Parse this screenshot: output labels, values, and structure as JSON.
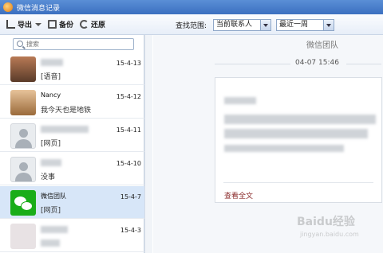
{
  "window": {
    "title": "微信消息记录"
  },
  "toolbar": {
    "export_label": "导出",
    "backup_label": "备份",
    "restore_label": "还原",
    "range_label": "查找范围:",
    "contact_select": "当前联系人",
    "period_select": "最近一周"
  },
  "sidebar": {
    "search_placeholder": "搜索",
    "items": [
      {
        "name": "",
        "date": "15-4-13",
        "preview": "[语音]",
        "avatar": "photo1"
      },
      {
        "name": "Nancy",
        "date": "15-4-12",
        "preview": "我今天也是地铁",
        "avatar": "photo2"
      },
      {
        "name": "",
        "date": "15-4-11",
        "preview": "[网页]",
        "avatar": "default"
      },
      {
        "name": "",
        "date": "15-4-10",
        "preview": "没事",
        "avatar": "default"
      },
      {
        "name": "微信团队",
        "date": "15-4-7",
        "preview": "[网页]",
        "avatar": "wechat",
        "selected": true
      },
      {
        "name": "",
        "date": "15-4-3",
        "preview": "",
        "avatar": "blur"
      }
    ]
  },
  "chat": {
    "title": "微信团队",
    "timestamp": "04-07 15:46",
    "view_full_label": "查看全文"
  },
  "watermark": {
    "brand": "Baidu经验",
    "url": "jingyan.baidu.com"
  }
}
